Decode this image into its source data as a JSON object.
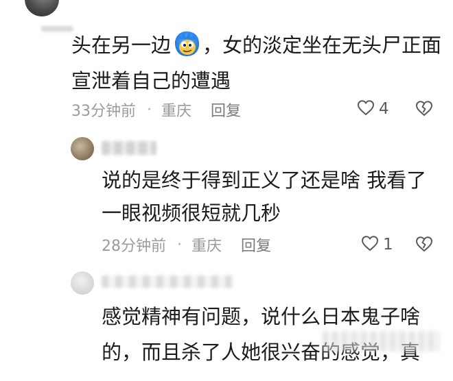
{
  "comments": [
    {
      "text_before_emoji": "头在另一边",
      "emoji": "cartoon-face-emoji",
      "text_after_emoji": "，女的淡定坐在无头尸正面宣泄着自己的遭遇",
      "time": "33分钟前",
      "separator": "·",
      "location": "重庆",
      "reply_label": "回复",
      "likes": "4"
    }
  ],
  "replies": [
    {
      "text": "说的是终于得到正义了还是啥 我看了一眼视频很短就几秒",
      "time": "28分钟前",
      "separator": "·",
      "location": "重庆",
      "reply_label": "回复",
      "likes": "1"
    },
    {
      "text": "感觉精神有问题，说什么日本鬼子啥的，而且杀了人她很兴奋的感觉，真"
    }
  ],
  "colors": {
    "text": "#1b1b1b",
    "meta": "#9b9b9b",
    "reply": "#7b7b7b",
    "icon": "#5a5a5a"
  }
}
